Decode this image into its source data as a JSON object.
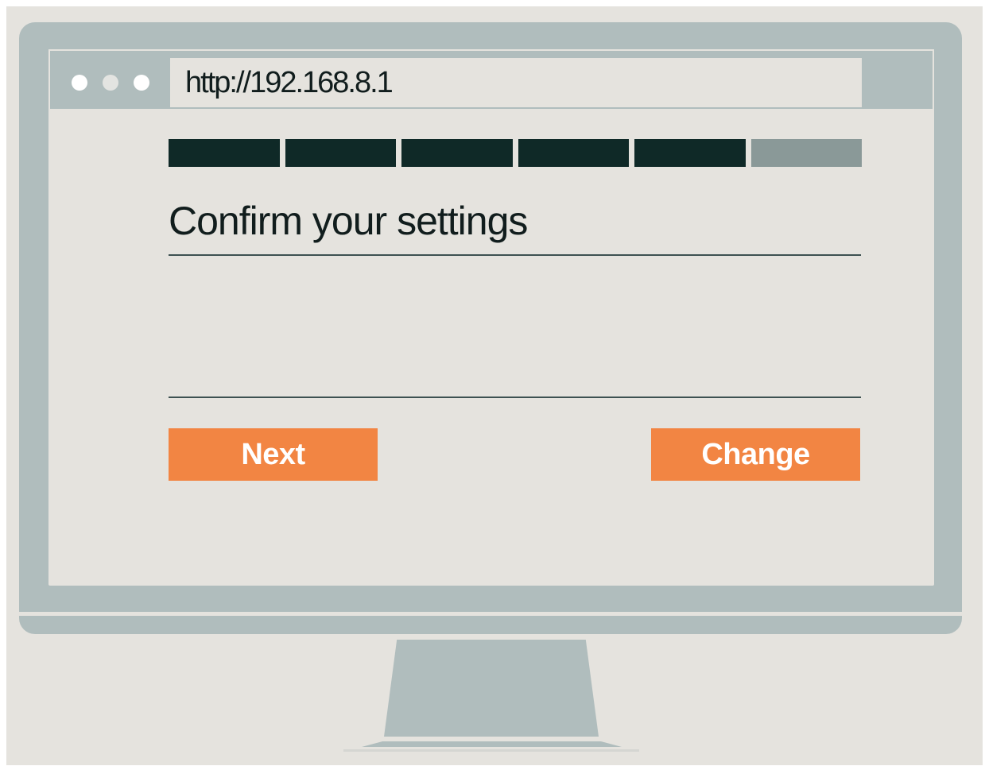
{
  "colors": {
    "background": "#e5e3de",
    "monitor_frame": "#b0bdbd",
    "text_dark": "#111d1d",
    "progress_done": "#0f2927",
    "progress_pending": "#8a9998",
    "button_accent": "#f28543",
    "button_text": "#ffffff",
    "dot_active": "#ffffff",
    "dot_inactive": "#e3e4e1"
  },
  "browser": {
    "url": "http://192.168.8.1",
    "window_dots": [
      {
        "icon": "window-dot-icon",
        "state": "active"
      },
      {
        "icon": "window-dot-icon",
        "state": "inactive"
      },
      {
        "icon": "window-dot-icon",
        "state": "active"
      }
    ]
  },
  "progress": {
    "total_steps": 6,
    "completed_steps": 5
  },
  "page": {
    "title": "Confirm your settings"
  },
  "actions": {
    "next_label": "Next",
    "change_label": "Change"
  }
}
